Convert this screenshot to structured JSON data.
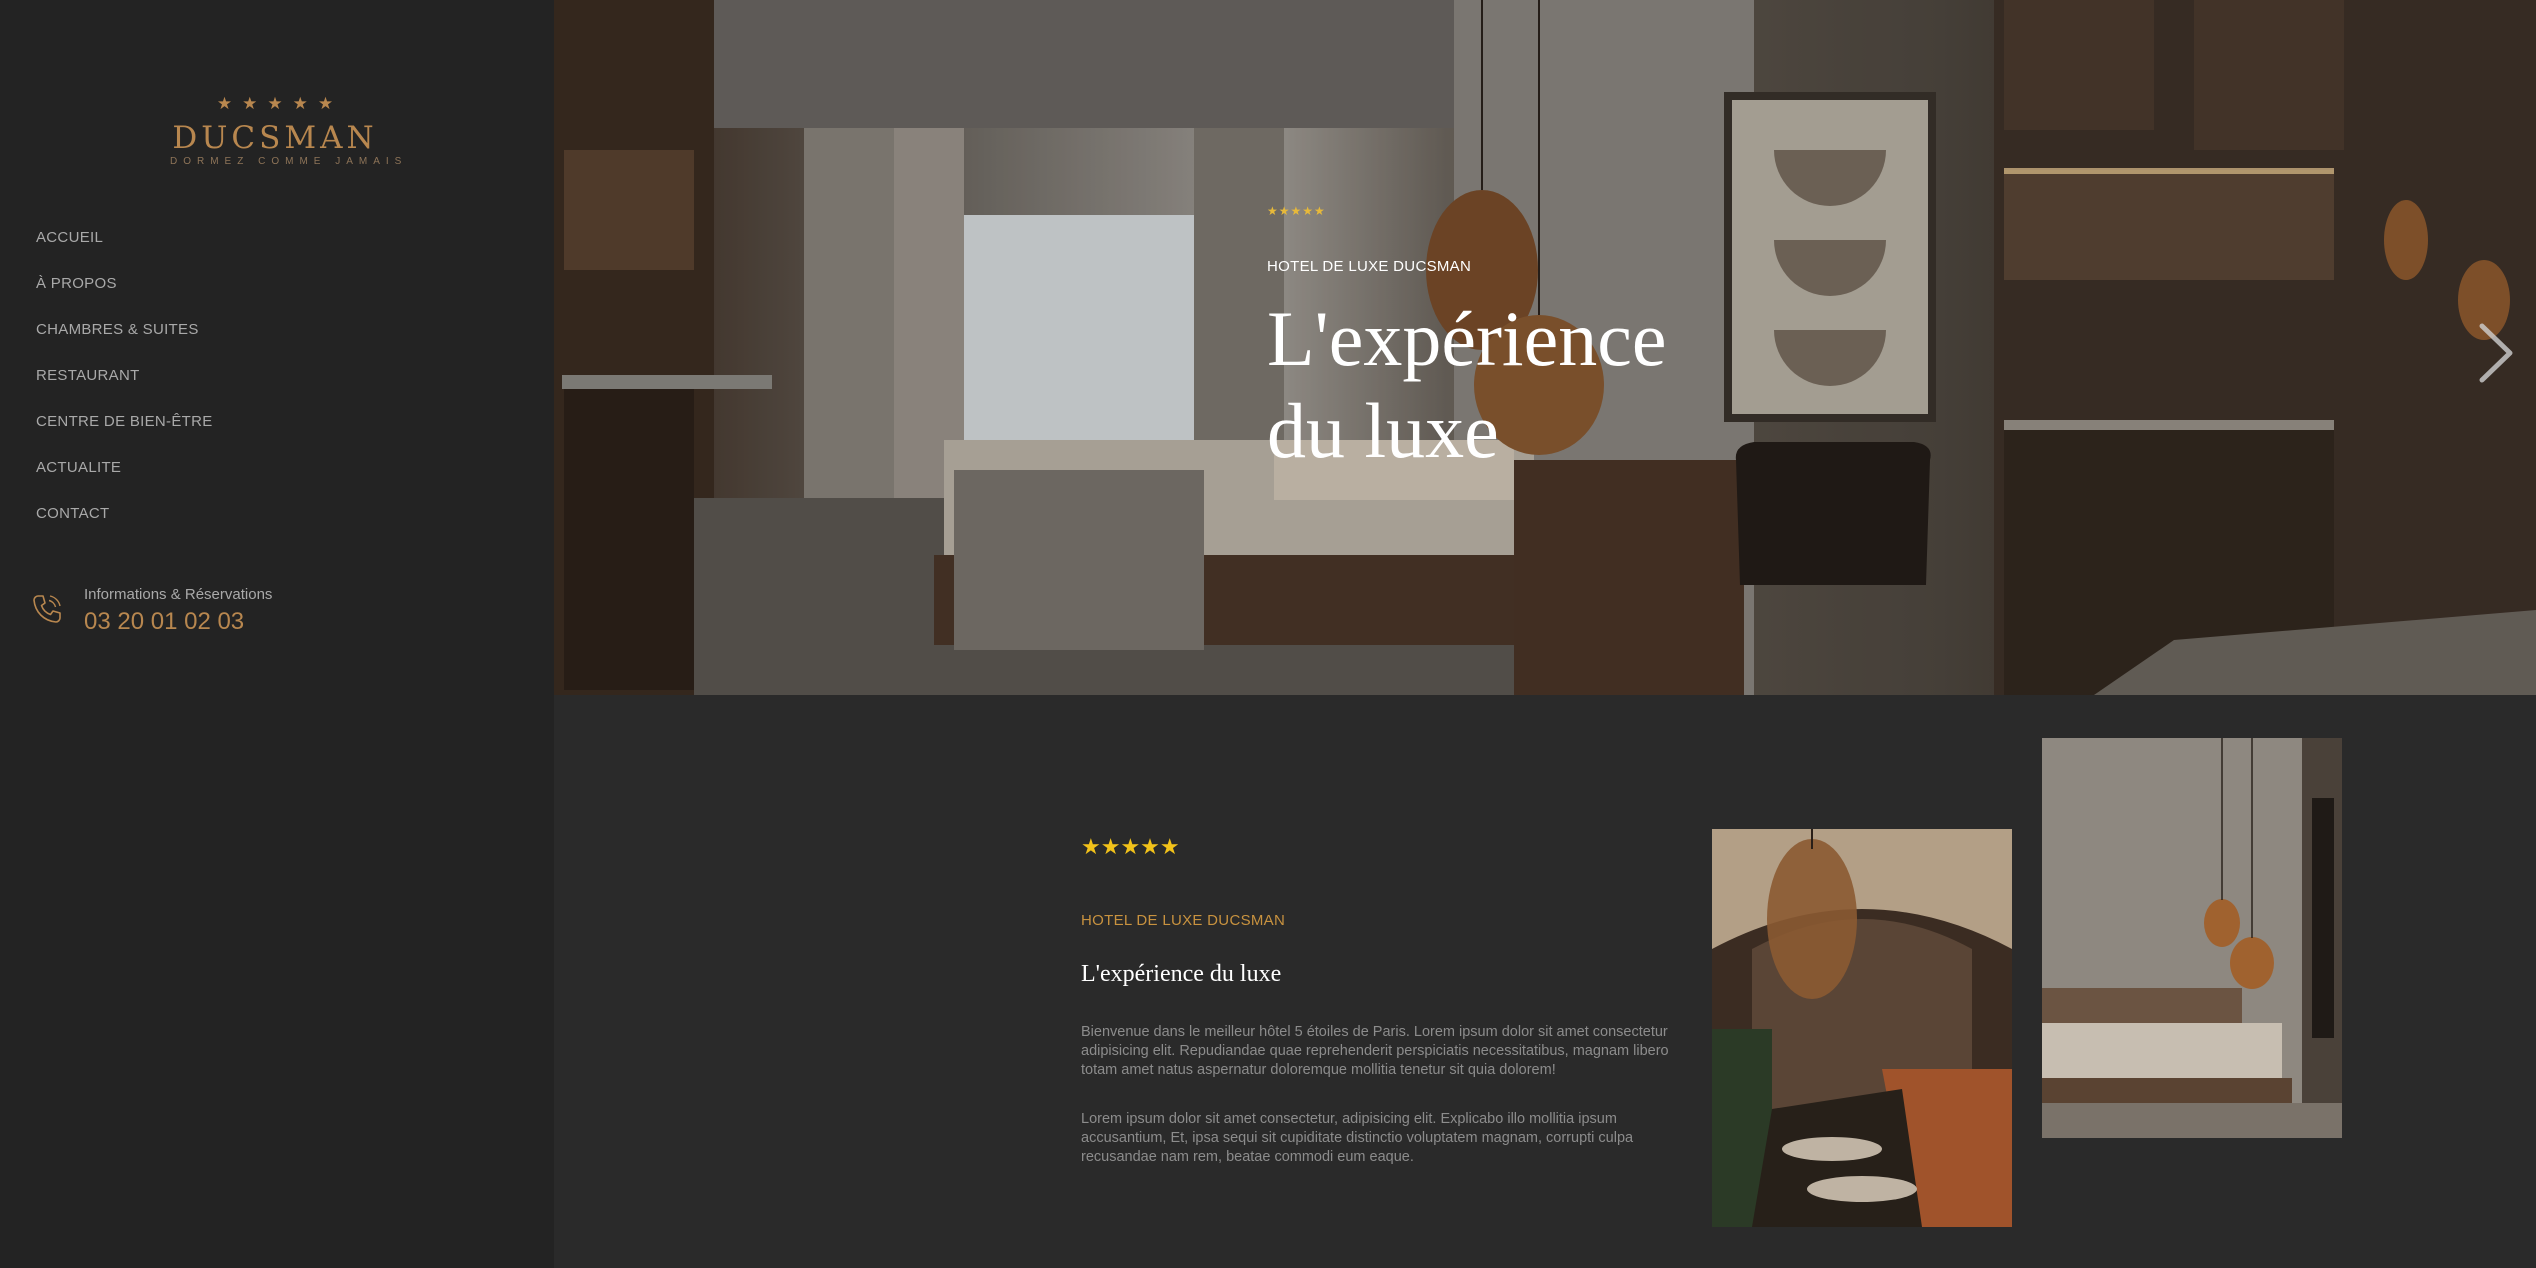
{
  "sidebar": {
    "logo": {
      "stars": "★★★★★",
      "name": "DUCSMAN",
      "tagline": "DORMEZ COMME JAMAIS"
    },
    "nav": [
      {
        "label": "ACCUEIL"
      },
      {
        "label": "À PROPOS"
      },
      {
        "label": "CHAMBRES & SUITES"
      },
      {
        "label": "RESTAURANT"
      },
      {
        "label": "CENTRE DE BIEN-ÊTRE"
      },
      {
        "label": "ACTUALITE"
      },
      {
        "label": "CONTACT"
      }
    ],
    "contact": {
      "icon": "phone-icon",
      "label": "Informations & Réservations",
      "phone": "03 20 01 02 03"
    }
  },
  "hero": {
    "stars": "★★★★★",
    "kicker": "HOTEL DE LUXE DUCSMAN",
    "title_line1": "L'expérience",
    "title_line2": "du luxe",
    "next_icon": "chevron-right-icon"
  },
  "intro": {
    "stars": "★★★★★",
    "kicker": "HOTEL DE LUXE DUCSMAN",
    "title": "L'expérience du luxe",
    "paragraph1": "Bienvenue dans le meilleur hôtel 5 étoiles de Paris. Lorem ipsum dolor sit amet consectetur adipisicing elit. Repudiandae quae reprehenderit perspiciatis necessitatibus, magnam libero totam amet natus aspernatur doloremque mollitia tenetur sit quia dolorem!",
    "paragraph2": "Lorem ipsum dolor sit amet consectetur, adipisicing elit. Explicabo illo mollitia ipsum accusantium, Et, ipsa sequi sit cupiditate distinctio voluptatem magnam, corrupti culpa recusandae nam rem, beatae commodi eum eaque."
  },
  "colors": {
    "sidebar_bg": "#232323",
    "page_bg": "#2a2a2a",
    "accent_gold": "#b8874f",
    "star_yellow": "#f2c21a"
  }
}
